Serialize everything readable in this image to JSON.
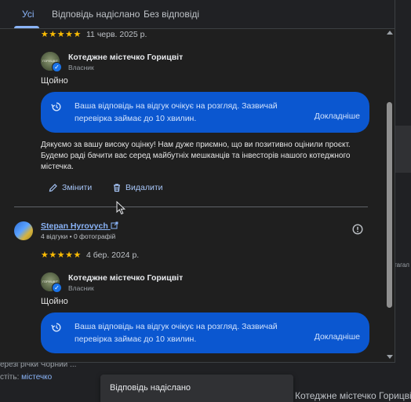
{
  "tabs": [
    {
      "label": "Усі"
    },
    {
      "label": "Відповідь надіслано"
    },
    {
      "label": "Без відповіді"
    }
  ],
  "review1": {
    "rating": "★★★★★",
    "date": "11 черв. 2025 р."
  },
  "owner": {
    "name": "Котеджне містечко Горицвіт",
    "role": "Власник",
    "avatar_text": "ГОРИЦВІТ"
  },
  "reply1": {
    "time": "Щойно",
    "notice": "Ваша відповідь на відгук очікує на розгляд. Зазвичай перевірка займає до 10 хвилин.",
    "more": "Докладніше",
    "text": "Дякуємо за вашу високу оцінку! Нам дуже приємно, що ви позитивно оцінили проєкт. Будемо раді бачити вас серед майбутніх мешканців та інвесторів нашого котеджного містечка.",
    "edit": "Змінити",
    "delete": "Видалити"
  },
  "review2": {
    "author": "Stepan Hyrovych",
    "meta": "4 відгуки • 0 фотографій",
    "rating": "★★★★★",
    "date": "4 бер. 2024 р."
  },
  "reply2": {
    "time": "Щойно",
    "notice": "Ваша відповідь на відгук очікує на розгляд. Зазвичай перевірка займає до 10 хвилин.",
    "more": "Докладніше"
  },
  "background": {
    "line1": "ерезі річки Чорний ...",
    "line2_label": "стіть:",
    "line2_link": "містечко",
    "right_title": "Котеджне містечко Горицвіт",
    "side_text": "єтагал"
  },
  "toast": "Відповідь надіслано",
  "colors": {
    "accent": "#8ab4f8",
    "notice_bg": "#0b57d0",
    "star": "#fbbc04"
  }
}
